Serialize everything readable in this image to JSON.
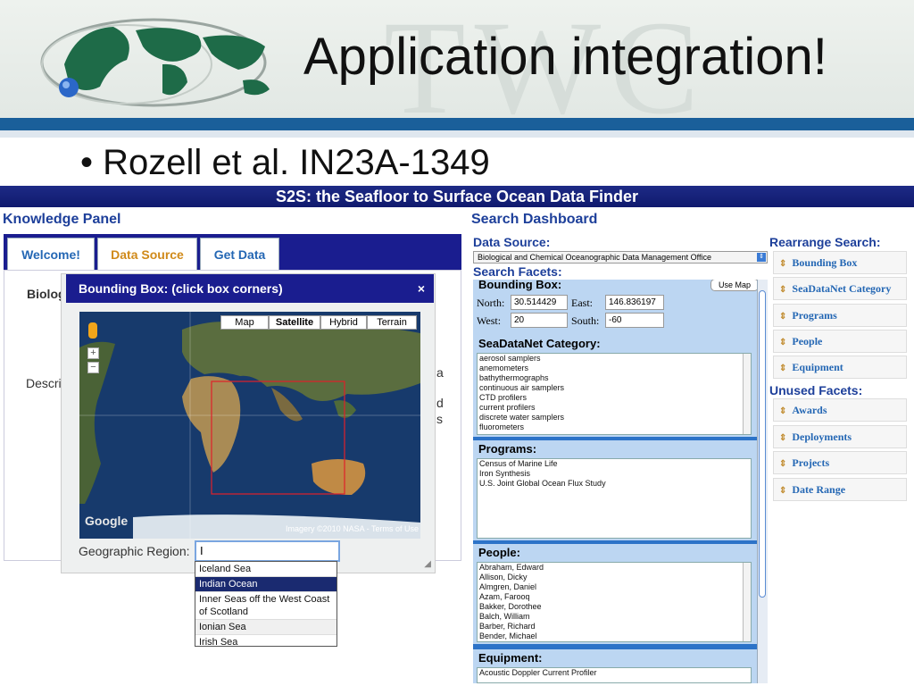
{
  "slide": {
    "title": "Application integration!",
    "watermark": "TWC",
    "bullet": "Rozell et al. IN23A-1349"
  },
  "app": {
    "title": "S2S: the Seafloor to Surface Ocean Data Finder",
    "knowledge_panel": {
      "title": "Knowledge Panel",
      "tabs": [
        "Welcome!",
        "Data Source",
        "Get Data"
      ],
      "active_tab": "Data Source",
      "hidden_text": [
        "Biolog",
        "Descri",
        "a",
        "d",
        "s"
      ]
    },
    "popup": {
      "title": "Bounding Box: (click box corners)",
      "close": "×",
      "map_types": [
        "Map",
        "Satellite",
        "Hybrid",
        "Terrain"
      ],
      "selected_map_type": "Satellite",
      "attribution": "Imagery ©2010 NASA - Terms of Use",
      "logo": "Google",
      "region_label": "Geographic Region:",
      "region_value": "I",
      "suggestions": [
        "Iceland Sea",
        "Indian Ocean",
        "Inner Seas off the West Coast of Scotland",
        "Ionian Sea",
        "Irish Sea"
      ],
      "selected_suggestion": "Indian Ocean"
    },
    "search_dashboard": {
      "title": "Search Dashboard",
      "data_source_label": "Data Source:",
      "data_source_value": "Biological and Chemical Oceanographic Data Management Office",
      "facets_label": "Search Facets:",
      "bounding_box": {
        "title": "Bounding Box:",
        "use_map": "Use Map",
        "north_label": "North:",
        "north": "30.514429",
        "east_label": "East:",
        "east": "146.836197",
        "west_label": "West:",
        "west": "20",
        "south_label": "South:",
        "south": "-60"
      },
      "seadatanet": {
        "title": "SeaDataNet Category:",
        "items": [
          "aerosol samplers",
          "anemometers",
          "bathythermographs",
          "continuous air samplers",
          "CTD profilers",
          "current profilers",
          "discrete water samplers",
          "fluorometers"
        ]
      },
      "programs": {
        "title": "Programs:",
        "items": [
          "Census of Marine Life",
          "Iron Synthesis",
          "U.S. Joint Global Ocean Flux Study"
        ]
      },
      "people": {
        "title": "People:",
        "items": [
          "Abraham, Edward",
          "Allison, Dicky",
          "Almgren, Daniel",
          "Azam, Farooq",
          "Bakker, Dorothee",
          "Balch, William",
          "Barber, Richard",
          "Bender, Michael"
        ]
      },
      "equipment": {
        "title": "Equipment:",
        "items": [
          "Acoustic Doppler Current Profiler"
        ]
      }
    },
    "rearrange": {
      "title": "Rearrange Search:",
      "items": [
        "Bounding Box",
        "SeaDataNet Category",
        "Programs",
        "People",
        "Equipment"
      ]
    },
    "unused": {
      "title": "Unused Facets:",
      "items": [
        "Awards",
        "Deployments",
        "Projects",
        "Date Range"
      ]
    },
    "colors": {
      "titlebar": "#1d2a86",
      "panel_title": "#1d3f9a",
      "facet_bg": "#2c73c8",
      "link": "#2467b4"
    }
  }
}
